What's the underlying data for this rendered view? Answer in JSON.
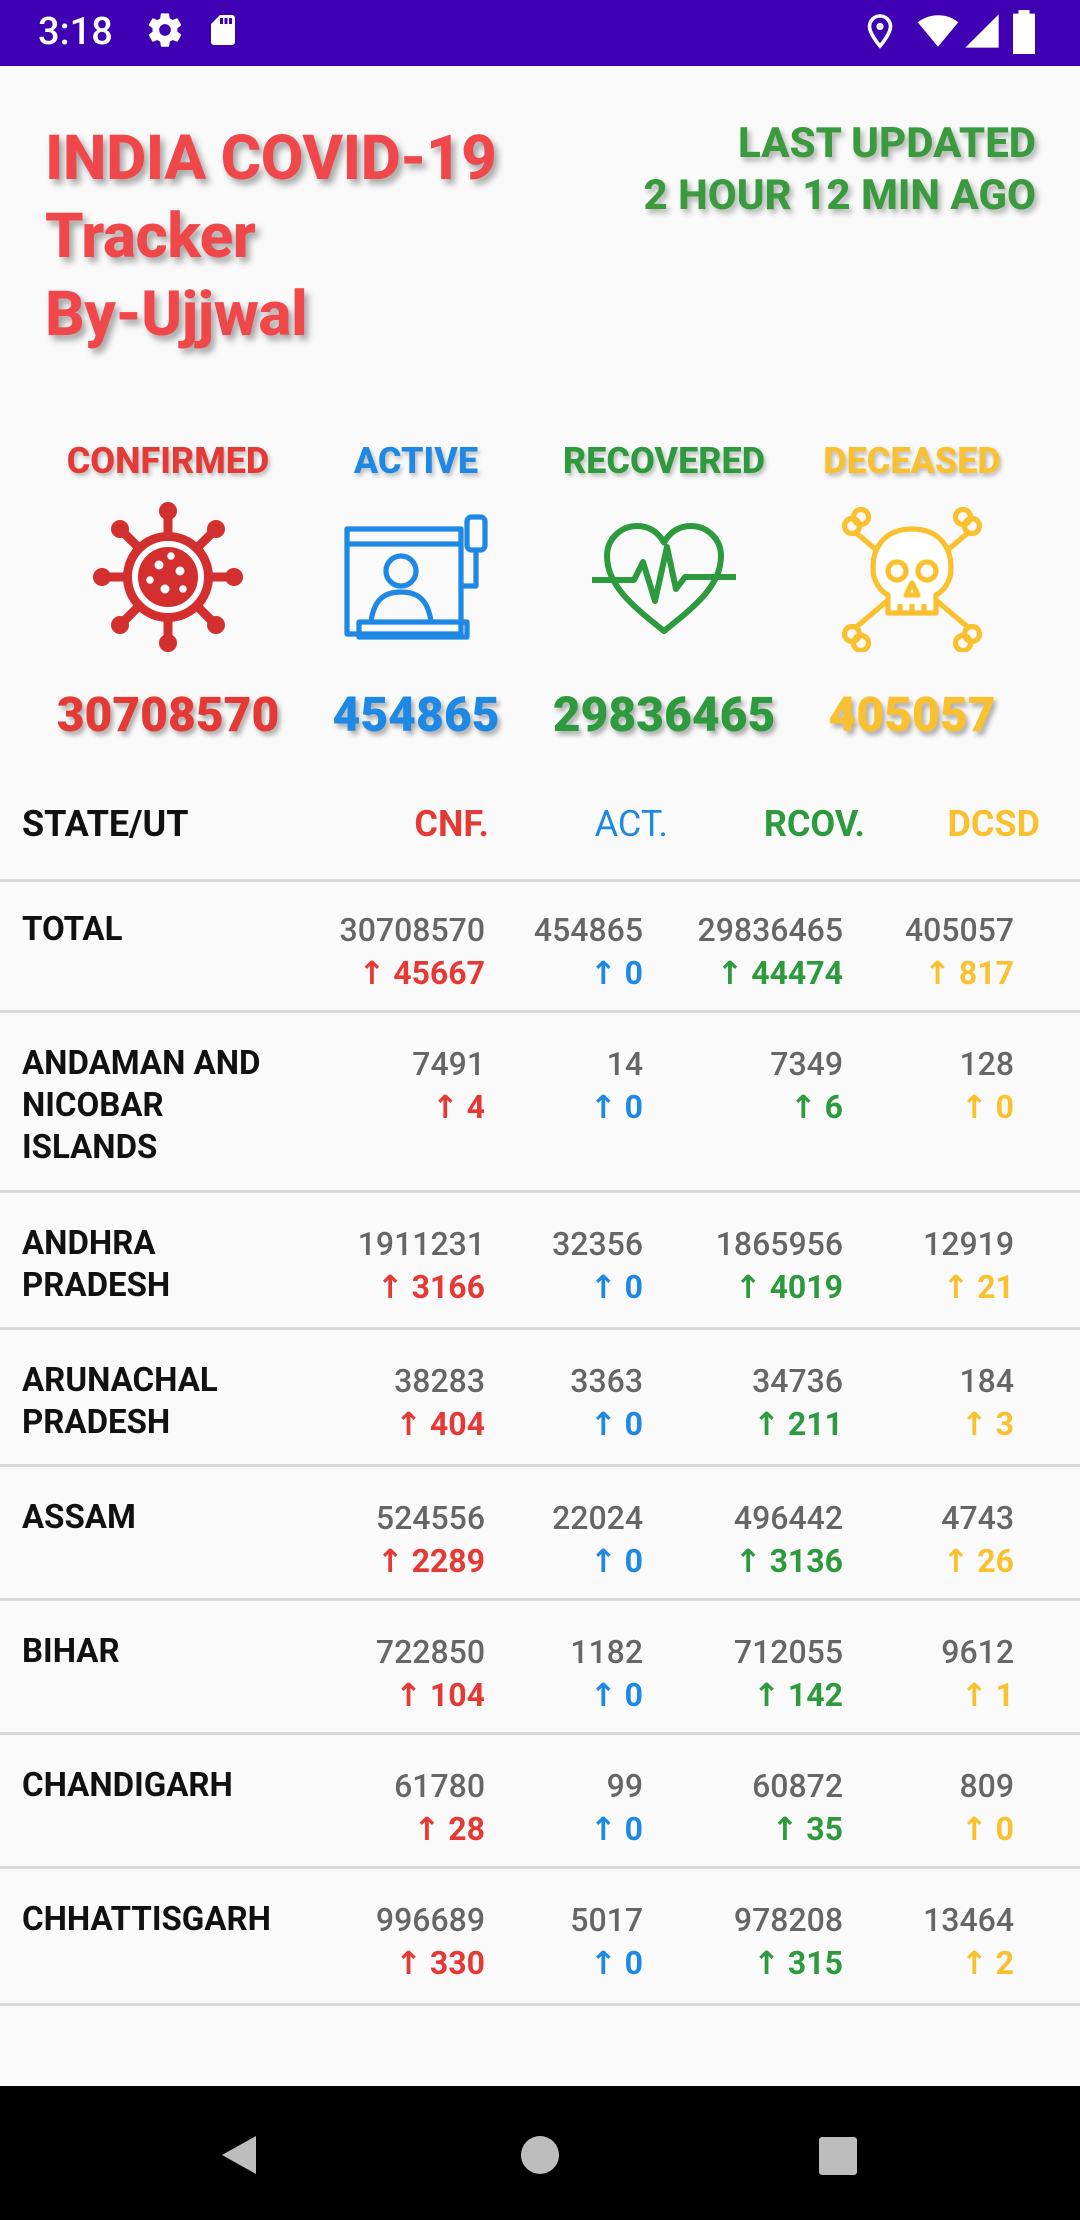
{
  "status_bar": {
    "time": "3:18"
  },
  "header": {
    "title_lines": [
      "INDIA COVID-19",
      "Tracker",
      "By-Ujjwal"
    ],
    "updated_line1": "LAST UPDATED",
    "updated_line2": "2 HOUR 12 MIN AGO"
  },
  "summary": [
    {
      "label": "CONFIRMED",
      "value": "30708570",
      "icon": "virus-icon",
      "color": "#e53935"
    },
    {
      "label": "ACTIVE",
      "value": "454865",
      "icon": "patient-bed-icon",
      "color": "#1e88e5"
    },
    {
      "label": "RECOVERED",
      "value": "29836465",
      "icon": "heartbeat-icon",
      "color": "#2e9a3e"
    },
    {
      "label": "DECEASED",
      "value": "405057",
      "icon": "skull-crossbones-icon",
      "color": "#fbc02d"
    }
  ],
  "table": {
    "headers": {
      "state": "STATE/UT",
      "cnf": "CNF.",
      "act": "ACT.",
      "rcov": "RCOV.",
      "dcsd": "DCSD"
    },
    "rows": [
      {
        "state": "TOTAL",
        "cnf": "30708570",
        "cnf_d": "↑ 45667",
        "act": "454865",
        "act_d": "↑ 0",
        "rcov": "29836465",
        "rcov_d": "↑ 44474",
        "dcsd": "405057",
        "dcsd_d": "↑ 817"
      },
      {
        "state": "ANDAMAN AND NICOBAR ISLANDS",
        "cnf": "7491",
        "cnf_d": "↑ 4",
        "act": "14",
        "act_d": "↑ 0",
        "rcov": "7349",
        "rcov_d": "↑ 6",
        "dcsd": "128",
        "dcsd_d": "↑ 0"
      },
      {
        "state": "ANDHRA PRADESH",
        "cnf": "1911231",
        "cnf_d": "↑ 3166",
        "act": "32356",
        "act_d": "↑ 0",
        "rcov": "1865956",
        "rcov_d": "↑ 4019",
        "dcsd": "12919",
        "dcsd_d": "↑ 21"
      },
      {
        "state": "ARUNACHAL PRADESH",
        "cnf": "38283",
        "cnf_d": "↑ 404",
        "act": "3363",
        "act_d": "↑ 0",
        "rcov": "34736",
        "rcov_d": "↑ 211",
        "dcsd": "184",
        "dcsd_d": "↑ 3"
      },
      {
        "state": "ASSAM",
        "cnf": "524556",
        "cnf_d": "↑ 2289",
        "act": "22024",
        "act_d": "↑ 0",
        "rcov": "496442",
        "rcov_d": "↑ 3136",
        "dcsd": "4743",
        "dcsd_d": "↑ 26"
      },
      {
        "state": "BIHAR",
        "cnf": "722850",
        "cnf_d": "↑ 104",
        "act": "1182",
        "act_d": "↑ 0",
        "rcov": "712055",
        "rcov_d": "↑ 142",
        "dcsd": "9612",
        "dcsd_d": "↑ 1"
      },
      {
        "state": "CHANDIGARH",
        "cnf": "61780",
        "cnf_d": "↑ 28",
        "act": "99",
        "act_d": "↑ 0",
        "rcov": "60872",
        "rcov_d": "↑ 35",
        "dcsd": "809",
        "dcsd_d": "↑ 0"
      },
      {
        "state": "CHHATTISGARH",
        "cnf": "996689",
        "cnf_d": "↑ 330",
        "act": "5017",
        "act_d": "↑ 0",
        "rcov": "978208",
        "rcov_d": "↑ 315",
        "dcsd": "13464",
        "dcsd_d": "↑ 2"
      }
    ]
  }
}
